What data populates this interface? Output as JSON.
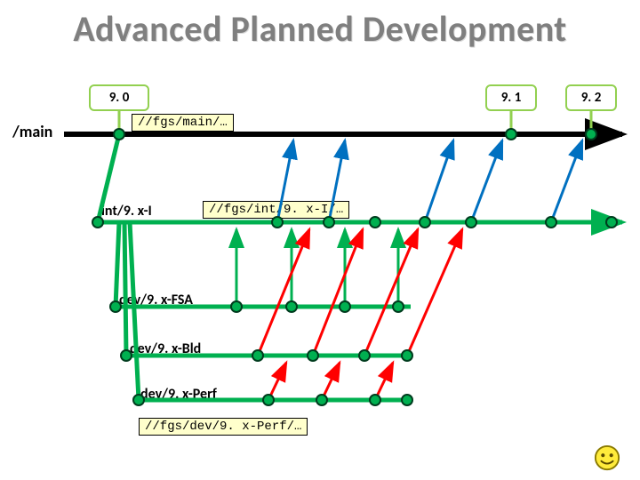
{
  "title": "Advanced Planned Development",
  "versions": {
    "v90": "9. 0",
    "v91": "9. 1",
    "v92": "9. 2"
  },
  "left_label": "/main",
  "callouts": {
    "main": "//fgs/main/…",
    "int": "//fgs/int/9. x-I/…",
    "perf": "//fgs/dev/9. x-Perf/…"
  },
  "branches": {
    "int": "int/9. x-I",
    "fsa": "dev/9. x-FSA",
    "bld": "dev/9. x-Bld",
    "perf": "dev/9. x-Perf"
  },
  "colors": {
    "main_line": "#000000",
    "int_line": "#00b050",
    "fsa_line": "#00b050",
    "bld_line": "#00b050",
    "perf_line": "#00b050",
    "up_fsa": "#0070c0",
    "up_fsa2": "#00b050",
    "up_bld": "#ff0000",
    "dot_fill": "#00b050",
    "dot_stroke": "#003c1e",
    "tag_border": "#92d050"
  },
  "branch_y": {
    "main": 151,
    "int": 250,
    "fsa": 345,
    "bld": 400,
    "perf": 450
  },
  "chart_data": {
    "type": "branch-diagram",
    "timeline_branch": "/main",
    "releases_on_main": [
      "9.0",
      "9.1",
      "9.2"
    ],
    "branches_from_main": [
      {
        "name": "int/9.x-I",
        "path": "//fgs/int/9.x-I/…",
        "children": [
          {
            "name": "dev/9.x-FSA",
            "merges_up_to": "int/9.x-I",
            "dots": 4
          },
          {
            "name": "dev/9.x-Bld",
            "merges_up_to": "dev/9.x-FSA",
            "dots": 4
          },
          {
            "name": "dev/9.x-Perf",
            "path": "//fgs/dev/9.x-Perf/…",
            "merges_up_to": "dev/9.x-Bld",
            "dots": 4
          }
        ],
        "merges_up_to": "/main",
        "dots": 6
      }
    ],
    "main_path": "//fgs/main/…",
    "merge_color_legend": {
      "int→main": "blue",
      "fsa→int": "green",
      "bld→int": "red"
    }
  }
}
